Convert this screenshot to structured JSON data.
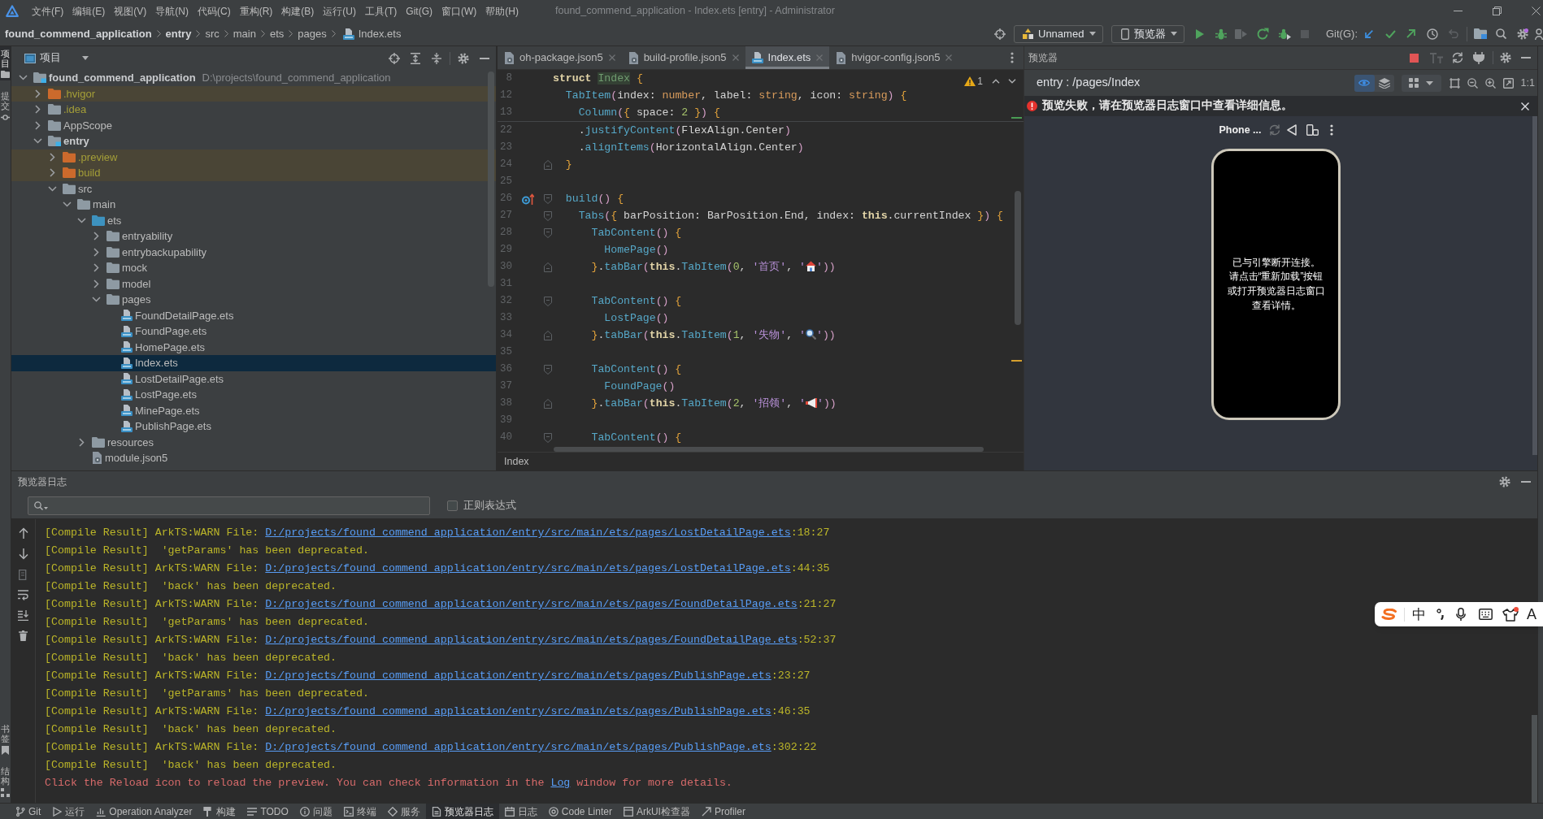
{
  "title_bar": {
    "menus": [
      "文件(F)",
      "编辑(E)",
      "视图(V)",
      "导航(N)",
      "代码(C)",
      "重构(R)",
      "构建(B)",
      "运行(U)",
      "工具(T)",
      "Git(G)",
      "窗口(W)",
      "帮助(H)"
    ],
    "title": "found_commend_application - Index.ets [entry] - Administrator"
  },
  "nav_bar": {
    "breadcrumbs": [
      {
        "label": "found_commend_application",
        "kind": "module"
      },
      {
        "label": "entry",
        "kind": "module"
      },
      {
        "label": "src",
        "kind": "folder"
      },
      {
        "label": "main",
        "kind": "folder"
      },
      {
        "label": "ets",
        "kind": "folder"
      },
      {
        "label": "pages",
        "kind": "folder"
      },
      {
        "label": "Index.ets",
        "kind": "file"
      }
    ],
    "run_config": "Unnamed",
    "device": "预览器",
    "git_label": "Git(G):"
  },
  "left_stripe": {
    "top": [
      {
        "label": "项目",
        "selected": true
      },
      {
        "label": "提交",
        "selected": false
      }
    ],
    "bottom": [
      {
        "label": "书签",
        "selected": false
      },
      {
        "label": "结构",
        "selected": false
      }
    ]
  },
  "project_panel": {
    "title": "项目",
    "tree": [
      {
        "label": "found_commend_application",
        "path": "D:\\projects\\found_commend_application",
        "kind": "module",
        "expanded": true,
        "selected": false,
        "children": [
          {
            "label": ".hvigor",
            "kind": "excluded",
            "expanded": false,
            "selected": false
          },
          {
            "label": ".idea",
            "kind": "ignored",
            "expanded": false,
            "selected": false
          },
          {
            "label": "AppScope",
            "kind": "folder",
            "expanded": false,
            "selected": false
          },
          {
            "label": "entry",
            "kind": "module",
            "expanded": true,
            "selected": false,
            "children": [
              {
                "label": ".preview",
                "kind": "excluded",
                "expanded": false,
                "selected": false
              },
              {
                "label": "build",
                "kind": "excluded",
                "expanded": false,
                "selected": false
              },
              {
                "label": "src",
                "kind": "folder",
                "expanded": true,
                "selected": false,
                "children": [
                  {
                    "label": "main",
                    "kind": "folder",
                    "expanded": true,
                    "selected": false,
                    "children": [
                      {
                        "label": "ets",
                        "kind": "source",
                        "expanded": true,
                        "selected": false,
                        "children": [
                          {
                            "label": "entryability",
                            "kind": "folder",
                            "expanded": false,
                            "selected": false
                          },
                          {
                            "label": "entrybackupability",
                            "kind": "folder",
                            "expanded": false,
                            "selected": false
                          },
                          {
                            "label": "mock",
                            "kind": "folder",
                            "expanded": false,
                            "selected": false
                          },
                          {
                            "label": "model",
                            "kind": "folder",
                            "expanded": false,
                            "selected": false
                          },
                          {
                            "label": "pages",
                            "kind": "folder",
                            "expanded": true,
                            "selected": false,
                            "children": [
                              {
                                "label": "FoundDetailPage.ets",
                                "kind": "ets",
                                "selected": false
                              },
                              {
                                "label": "FoundPage.ets",
                                "kind": "ets",
                                "selected": false
                              },
                              {
                                "label": "HomePage.ets",
                                "kind": "ets",
                                "selected": false
                              },
                              {
                                "label": "Index.ets",
                                "kind": "ets",
                                "selected": true
                              },
                              {
                                "label": "LostDetailPage.ets",
                                "kind": "ets",
                                "selected": false
                              },
                              {
                                "label": "LostPage.ets",
                                "kind": "ets",
                                "selected": false
                              },
                              {
                                "label": "MinePage.ets",
                                "kind": "ets",
                                "selected": false
                              },
                              {
                                "label": "PublishPage.ets",
                                "kind": "ets",
                                "selected": false
                              }
                            ]
                          }
                        ]
                      },
                      {
                        "label": "resources",
                        "kind": "folder",
                        "expanded": false,
                        "selected": false
                      },
                      {
                        "label": "module.json5",
                        "kind": "config",
                        "selected": false
                      }
                    ]
                  }
                ]
              }
            ]
          }
        ]
      }
    ]
  },
  "editor": {
    "tabs": [
      {
        "label": "oh-package.json5",
        "kind": "config",
        "selected": false
      },
      {
        "label": "build-profile.json5",
        "kind": "config",
        "selected": false
      },
      {
        "label": "Index.ets",
        "kind": "ets",
        "selected": true
      },
      {
        "label": "hvigor-config.json5",
        "kind": "config",
        "selected": false
      }
    ],
    "warning_count": "1",
    "sticky_lines": [
      {
        "number": "8",
        "tokens": [
          {
            "kind": "kw",
            "text": "struct "
          },
          {
            "kind": "decl",
            "text": "Index"
          },
          {
            "kind": "brace",
            "text": " {"
          }
        ]
      },
      {
        "number": "12",
        "tokens": [
          {
            "kind": "call",
            "text": "  TabItem"
          },
          {
            "kind": "paren",
            "text": "("
          },
          {
            "kind": "plain",
            "text": "index: "
          },
          {
            "kind": "type",
            "text": "number"
          },
          {
            "kind": "plain",
            "text": ", label: "
          },
          {
            "kind": "type",
            "text": "string"
          },
          {
            "kind": "plain",
            "text": ", icon: "
          },
          {
            "kind": "type",
            "text": "string"
          },
          {
            "kind": "paren",
            "text": ")"
          },
          {
            "kind": "brace",
            "text": " {"
          }
        ]
      },
      {
        "number": "13",
        "tokens": [
          {
            "kind": "call",
            "text": "    Column"
          },
          {
            "kind": "paren",
            "text": "("
          },
          {
            "kind": "brace",
            "text": "{"
          },
          {
            "kind": "plain",
            "text": " space: "
          },
          {
            "kind": "num",
            "text": "2"
          },
          {
            "kind": "brace",
            "text": " }"
          },
          {
            "kind": "paren",
            "text": ")"
          },
          {
            "kind": "brace",
            "text": " {"
          }
        ]
      }
    ],
    "lines": [
      {
        "number": "22",
        "tokens": [
          {
            "kind": "plain",
            "text": "    ."
          },
          {
            "kind": "call",
            "text": "justifyContent"
          },
          {
            "kind": "paren",
            "text": "("
          },
          {
            "kind": "plain",
            "text": "FlexAlign.Center"
          },
          {
            "kind": "paren",
            "text": ")"
          }
        ]
      },
      {
        "number": "23",
        "tokens": [
          {
            "kind": "plain",
            "text": "    ."
          },
          {
            "kind": "call",
            "text": "alignItems"
          },
          {
            "kind": "paren",
            "text": "("
          },
          {
            "kind": "plain",
            "text": "HorizontalAlign.Center"
          },
          {
            "kind": "paren",
            "text": ")"
          }
        ]
      },
      {
        "number": "24",
        "fold_end": true,
        "tokens": [
          {
            "kind": "brace",
            "text": "  }"
          }
        ]
      },
      {
        "number": "25"
      },
      {
        "number": "26",
        "fold_start": true,
        "override_marker": true,
        "tokens": [
          {
            "kind": "call",
            "text": "  build"
          },
          {
            "kind": "paren",
            "text": "()"
          },
          {
            "kind": "brace",
            "text": " {"
          }
        ]
      },
      {
        "number": "27",
        "fold_start": true,
        "tokens": [
          {
            "kind": "call",
            "text": "    Tabs"
          },
          {
            "kind": "paren",
            "text": "("
          },
          {
            "kind": "brace",
            "text": "{"
          },
          {
            "kind": "plain",
            "text": " barPosition: BarPosition.End, index: "
          },
          {
            "kind": "kw",
            "text": "this"
          },
          {
            "kind": "plain",
            "text": ".currentIndex "
          },
          {
            "kind": "brace",
            "text": "}"
          },
          {
            "kind": "paren",
            "text": ")"
          },
          {
            "kind": "brace",
            "text": " {"
          }
        ]
      },
      {
        "number": "28",
        "fold_start": true,
        "tokens": [
          {
            "kind": "call",
            "text": "      TabContent"
          },
          {
            "kind": "paren",
            "text": "()"
          },
          {
            "kind": "brace",
            "text": " {"
          }
        ]
      },
      {
        "number": "29",
        "tokens": [
          {
            "kind": "call",
            "text": "        HomePage"
          },
          {
            "kind": "paren",
            "text": "()"
          }
        ]
      },
      {
        "number": "30",
        "fold_end": true,
        "tokens": [
          {
            "kind": "brace",
            "text": "      }"
          },
          {
            "kind": "plain",
            "text": "."
          },
          {
            "kind": "call",
            "text": "tabBar"
          },
          {
            "kind": "paren",
            "text": "("
          },
          {
            "kind": "kw",
            "text": "this"
          },
          {
            "kind": "plain",
            "text": "."
          },
          {
            "kind": "call",
            "text": "TabItem"
          },
          {
            "kind": "paren",
            "text": "("
          },
          {
            "kind": "num",
            "text": "0"
          },
          {
            "kind": "plain",
            "text": ", "
          },
          {
            "kind": "str",
            "text": "'首页'"
          },
          {
            "kind": "plain",
            "text": ", "
          },
          {
            "kind": "str",
            "text": "'"
          },
          {
            "kind": "house"
          },
          {
            "kind": "str",
            "text": "'"
          },
          {
            "kind": "paren",
            "text": "))"
          }
        ]
      },
      {
        "number": "31"
      },
      {
        "number": "32",
        "fold_start": true,
        "tokens": [
          {
            "kind": "call",
            "text": "      TabContent"
          },
          {
            "kind": "paren",
            "text": "()"
          },
          {
            "kind": "brace",
            "text": " {"
          }
        ]
      },
      {
        "number": "33",
        "tokens": [
          {
            "kind": "call",
            "text": "        LostPage"
          },
          {
            "kind": "paren",
            "text": "()"
          }
        ]
      },
      {
        "number": "34",
        "fold_end": true,
        "tokens": [
          {
            "kind": "brace",
            "text": "      }"
          },
          {
            "kind": "plain",
            "text": "."
          },
          {
            "kind": "call",
            "text": "tabBar"
          },
          {
            "kind": "paren",
            "text": "("
          },
          {
            "kind": "kw",
            "text": "this"
          },
          {
            "kind": "plain",
            "text": "."
          },
          {
            "kind": "call",
            "text": "TabItem"
          },
          {
            "kind": "paren",
            "text": "("
          },
          {
            "kind": "num",
            "text": "1"
          },
          {
            "kind": "plain",
            "text": ", "
          },
          {
            "kind": "str",
            "text": "'失物'"
          },
          {
            "kind": "plain",
            "text": ", "
          },
          {
            "kind": "str",
            "text": "'"
          },
          {
            "kind": "magnifier"
          },
          {
            "kind": "str",
            "text": "'"
          },
          {
            "kind": "paren",
            "text": "))"
          }
        ]
      },
      {
        "number": "35"
      },
      {
        "number": "36",
        "fold_start": true,
        "tokens": [
          {
            "kind": "call",
            "text": "      TabContent"
          },
          {
            "kind": "paren",
            "text": "()"
          },
          {
            "kind": "brace",
            "text": " {"
          }
        ]
      },
      {
        "number": "37",
        "tokens": [
          {
            "kind": "call",
            "text": "        FoundPage"
          },
          {
            "kind": "paren",
            "text": "()"
          }
        ]
      },
      {
        "number": "38",
        "fold_end": true,
        "tokens": [
          {
            "kind": "brace",
            "text": "      }"
          },
          {
            "kind": "plain",
            "text": "."
          },
          {
            "kind": "call",
            "text": "tabBar"
          },
          {
            "kind": "paren",
            "text": "("
          },
          {
            "kind": "kw",
            "text": "this"
          },
          {
            "kind": "plain",
            "text": "."
          },
          {
            "kind": "call",
            "text": "TabItem"
          },
          {
            "kind": "paren",
            "text": "("
          },
          {
            "kind": "num",
            "text": "2"
          },
          {
            "kind": "plain",
            "text": ", "
          },
          {
            "kind": "str",
            "text": "'招领'"
          },
          {
            "kind": "plain",
            "text": ", "
          },
          {
            "kind": "str",
            "text": "'"
          },
          {
            "kind": "megaphone"
          },
          {
            "kind": "str",
            "text": "'"
          },
          {
            "kind": "paren",
            "text": "))"
          }
        ]
      },
      {
        "number": "39"
      },
      {
        "number": "40",
        "fold_start": true,
        "tokens": [
          {
            "kind": "call",
            "text": "      TabContent"
          },
          {
            "kind": "paren",
            "text": "()"
          },
          {
            "kind": "brace",
            "text": " {"
          }
        ]
      }
    ],
    "breadcrumb": "Index"
  },
  "preview": {
    "title": "预览器",
    "route": "entry : /pages/Index",
    "inspect_selected": true,
    "zoom_label": "1:1",
    "error": "预览失败，请在预览器日志窗口中查看详细信息。",
    "device": "Phone ...",
    "screen_message": [
      "已与引擎断开连接。",
      "请点击“重新加载”按钮",
      "或打开预览器日志窗口",
      "查看详情。"
    ]
  },
  "log_panel": {
    "title": "预览器日志",
    "regex": {
      "label": "正则表达式",
      "checked": false
    },
    "lines": [
      {
        "kind": "warn",
        "text": "[Compile Result] ArkTS:WARN File: ",
        "link": "D:/projects/found_commend_application/entry/src/main/ets/pages/LostDetailPage.ets",
        "suffix": ":18:27"
      },
      {
        "kind": "warn",
        "text": "[Compile Result]  'getParams' has been deprecated."
      },
      {
        "kind": "warn",
        "text": "[Compile Result] ArkTS:WARN File: ",
        "link": "D:/projects/found_commend_application/entry/src/main/ets/pages/LostDetailPage.ets",
        "suffix": ":44:35"
      },
      {
        "kind": "warn",
        "text": "[Compile Result]  'back' has been deprecated."
      },
      {
        "kind": "warn",
        "text": "[Compile Result] ArkTS:WARN File: ",
        "link": "D:/projects/found_commend_application/entry/src/main/ets/pages/FoundDetailPage.ets",
        "suffix": ":21:27"
      },
      {
        "kind": "warn",
        "text": "[Compile Result]  'getParams' has been deprecated."
      },
      {
        "kind": "warn",
        "text": "[Compile Result] ArkTS:WARN File: ",
        "link": "D:/projects/found_commend_application/entry/src/main/ets/pages/FoundDetailPage.ets",
        "suffix": ":52:37"
      },
      {
        "kind": "warn",
        "text": "[Compile Result]  'back' has been deprecated."
      },
      {
        "kind": "warn",
        "text": "[Compile Result] ArkTS:WARN File: ",
        "link": "D:/projects/found_commend_application/entry/src/main/ets/pages/PublishPage.ets",
        "suffix": ":23:27"
      },
      {
        "kind": "warn",
        "text": "[Compile Result]  'getParams' has been deprecated."
      },
      {
        "kind": "warn",
        "text": "[Compile Result] ArkTS:WARN File: ",
        "link": "D:/projects/found_commend_application/entry/src/main/ets/pages/PublishPage.ets",
        "suffix": ":46:35"
      },
      {
        "kind": "warn",
        "text": "[Compile Result]  'back' has been deprecated."
      },
      {
        "kind": "warn",
        "text": "[Compile Result] ArkTS:WARN File: ",
        "link": "D:/projects/found_commend_application/entry/src/main/ets/pages/PublishPage.ets",
        "suffix": ":302:22"
      },
      {
        "kind": "warn",
        "text": "[Compile Result]  'back' has been deprecated."
      },
      {
        "kind": "error",
        "text": "Click the Reload icon to reload the preview. You can check information in the ",
        "link": "Log",
        "suffix": " window for more details."
      }
    ]
  },
  "tool_windows": [
    {
      "label": "Git",
      "selected": false
    },
    {
      "label": "运行",
      "selected": false
    },
    {
      "label": "Operation Analyzer",
      "selected": false
    },
    {
      "label": "构建",
      "selected": false
    },
    {
      "label": "TODO",
      "selected": false
    },
    {
      "label": "问题",
      "selected": false
    },
    {
      "label": "终端",
      "selected": false
    },
    {
      "label": "服务",
      "selected": false
    },
    {
      "label": "预览器日志",
      "selected": true
    },
    {
      "label": "日志",
      "selected": false
    },
    {
      "label": "Code Linter",
      "selected": false
    },
    {
      "label": "ArkUI检查器",
      "selected": false
    },
    {
      "label": "Profiler",
      "selected": false
    }
  ],
  "ime_toolbar": {
    "mode": "中",
    "trailing_label": "A"
  }
}
